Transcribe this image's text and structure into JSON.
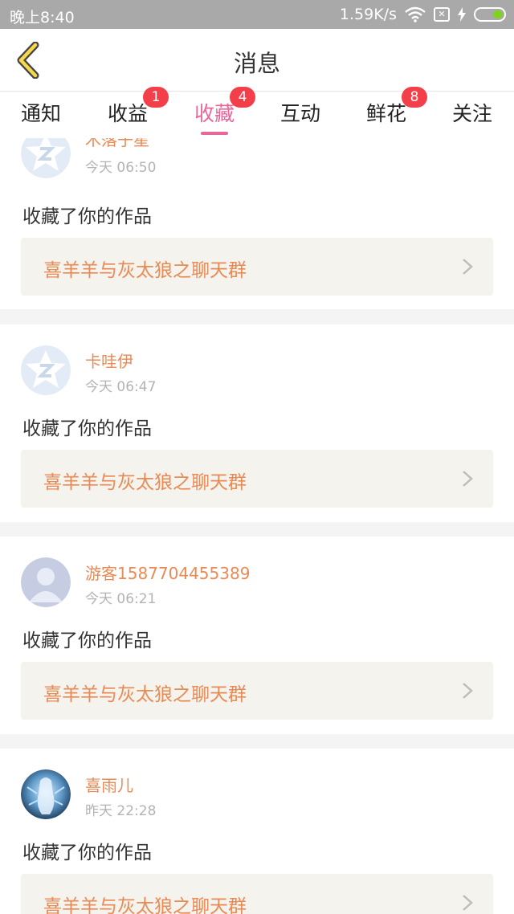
{
  "status_bar": {
    "time": "晚上8:40",
    "speed": "1.59K/s",
    "icons": [
      "wifi-icon",
      "sim-off-icon",
      "charging-icon",
      "battery-icon"
    ]
  },
  "header": {
    "title": "消息",
    "back_icon": "chevron-left-icon"
  },
  "tabs": [
    {
      "label": "通知",
      "badge": null,
      "active": false
    },
    {
      "label": "收益",
      "badge": "1",
      "active": false
    },
    {
      "label": "收藏",
      "badge": "4",
      "active": true
    },
    {
      "label": "互动",
      "badge": null,
      "active": false
    },
    {
      "label": "鲜花",
      "badge": "8",
      "active": false
    },
    {
      "label": "关注",
      "badge": null,
      "active": false
    }
  ],
  "colors": {
    "accent": "#e9669a",
    "name": "#ea8a55",
    "badge": "#f23f4a"
  },
  "items": [
    {
      "name": "木落子星",
      "time": "今天 06:50",
      "action": "收藏了你的作品",
      "work": "喜羊羊与灰太狼之聊天群",
      "avatar": "qzone-default-icon"
    },
    {
      "name": "卡哇伊",
      "time": "今天 06:47",
      "action": "收藏了你的作品",
      "work": "喜羊羊与灰太狼之聊天群",
      "avatar": "qzone-default-icon"
    },
    {
      "name": "游客1587704455389",
      "time": "今天 06:21",
      "action": "收藏了你的作品",
      "work": "喜羊羊与灰太狼之聊天群",
      "avatar": "guest-avatar-icon"
    },
    {
      "name": "喜雨儿",
      "time": "昨天 22:28",
      "action": "收藏了你的作品",
      "work": "喜羊羊与灰太狼之聊天群",
      "avatar": "anime-avatar"
    }
  ]
}
